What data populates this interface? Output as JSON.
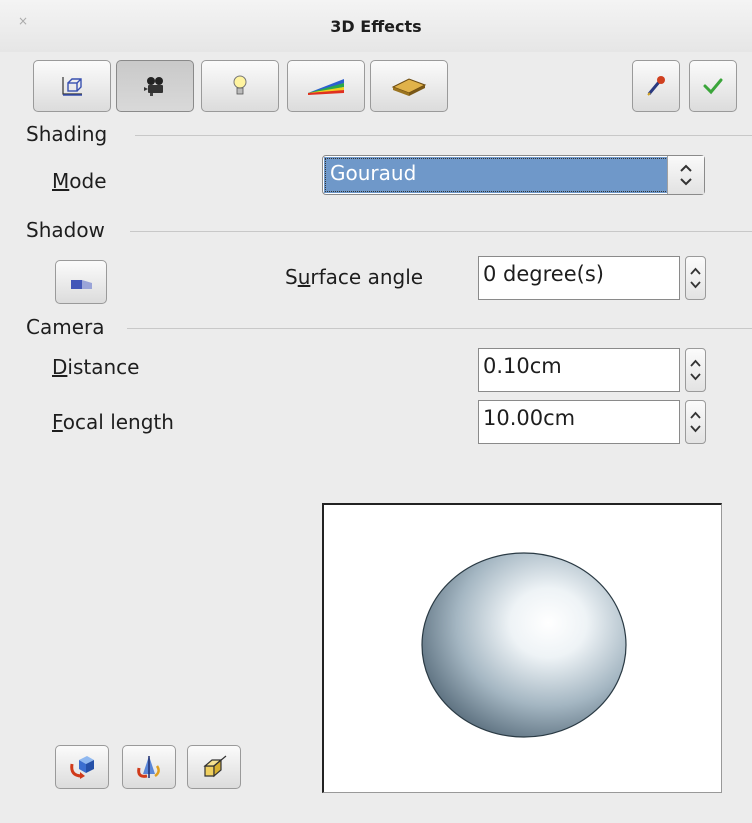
{
  "window": {
    "title": "3D Effects",
    "close_glyph": "×"
  },
  "toolbar": {
    "buttons": [
      {
        "icon": "geometry-icon",
        "pressed": false
      },
      {
        "icon": "shading-camera-icon",
        "pressed": true
      },
      {
        "icon": "illumination-bulb-icon",
        "pressed": false
      },
      {
        "icon": "textures-icon",
        "pressed": false
      },
      {
        "icon": "material-icon",
        "pressed": false
      }
    ],
    "right_buttons": [
      {
        "icon": "eyedropper-icon"
      },
      {
        "icon": "checkmark-icon"
      }
    ]
  },
  "shading": {
    "header": "Shading",
    "mode_label_u": "M",
    "mode_label_rest": "ode",
    "mode_value": "Gouraud",
    "arrow_glyph": "⌃⌄"
  },
  "shadow": {
    "header": "Shadow",
    "surface_label_pre": "S",
    "surface_label_u": "u",
    "surface_label_rest": "rface angle",
    "surface_value": "0 degree(s)"
  },
  "camera": {
    "header": "Camera",
    "distance_label_u": "D",
    "distance_label_rest": "istance",
    "distance_value": "0.10cm",
    "focal_label_u": "F",
    "focal_label_rest": "ocal length",
    "focal_value": "10.00cm"
  },
  "bottom_buttons": [
    {
      "icon": "convert-to-3d-icon"
    },
    {
      "icon": "convert-to-rotation-object-icon"
    },
    {
      "icon": "perspective-on-off-icon"
    }
  ],
  "colors": {
    "selection": "#6f98c9"
  }
}
